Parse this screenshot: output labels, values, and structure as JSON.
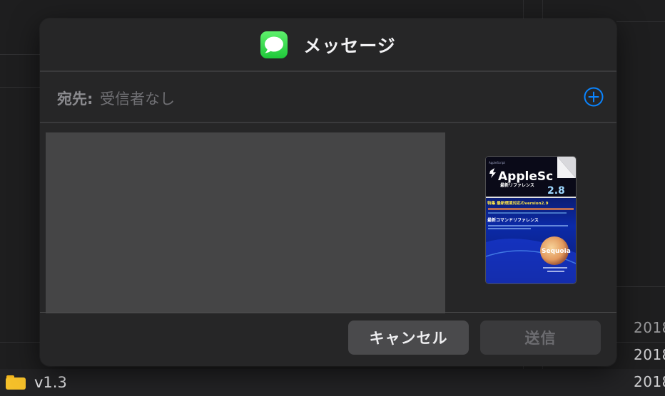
{
  "background": {
    "years": [
      "2018",
      "2018",
      "2018"
    ],
    "folder_name": "v1.3"
  },
  "dialog": {
    "title": "メッセージ",
    "app_icon": "messages-app-icon",
    "to_label": "宛先:",
    "to_value": "受信者なし",
    "add_icon": "plus-circle-icon",
    "attachment": {
      "title_word": "AppleSc",
      "subtitle": "最新リファレンス",
      "version": "2.8",
      "feature_line": "特集 最新環境対応のversion2.9",
      "section": "最新コマンドリファレンス",
      "os_label": "Sequoia"
    },
    "cancel_label": "キャンセル",
    "send_label": "送信"
  },
  "colors": {
    "accent_blue": "#0a84ff",
    "messages_green": "#34c759",
    "dialog_bg": "#262627"
  }
}
